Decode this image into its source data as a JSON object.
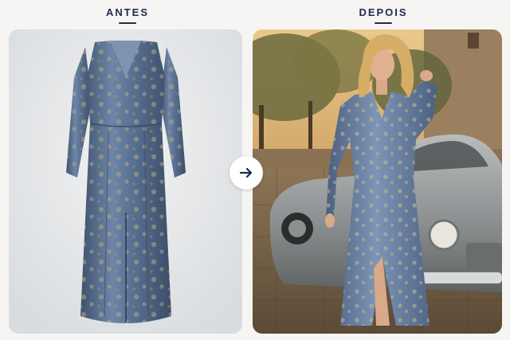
{
  "before": {
    "label": "ANTES"
  },
  "after": {
    "label": "DEPOIS"
  },
  "icons": {
    "compare": "arrow-right-icon"
  },
  "colors": {
    "accent": "#1f2a52",
    "dress": "#5e7597"
  }
}
